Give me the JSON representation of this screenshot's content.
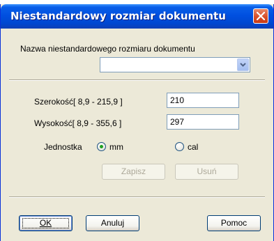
{
  "dialog": {
    "title": "Niestandardowy rozmiar dokumentu",
    "name_label": "Nazwa niestandardowego rozmiaru dokumentu",
    "name_value": "",
    "width_label": "Szerokość[  8,9  -  215,9  ]",
    "width_value": "210",
    "height_label": "Wysokość[  8,9  -  355,6  ]",
    "height_value": "297",
    "unit_label": "Jednostka",
    "unit_options": [
      {
        "label": "mm",
        "selected": true
      },
      {
        "label": "cal",
        "selected": false
      }
    ],
    "save_label": "Zapisz",
    "delete_label": "Usuń",
    "ok_label": "OK",
    "cancel_label": "Anuluj",
    "help_label": "Pomoc"
  },
  "colors": {
    "titlebar": "#0050e0",
    "close": "#d8502a",
    "dialog_bg": "#ece9d8",
    "radio_dot": "#21a121"
  },
  "icons": {
    "close": "close-icon",
    "dropdown": "chevron-down-icon"
  }
}
